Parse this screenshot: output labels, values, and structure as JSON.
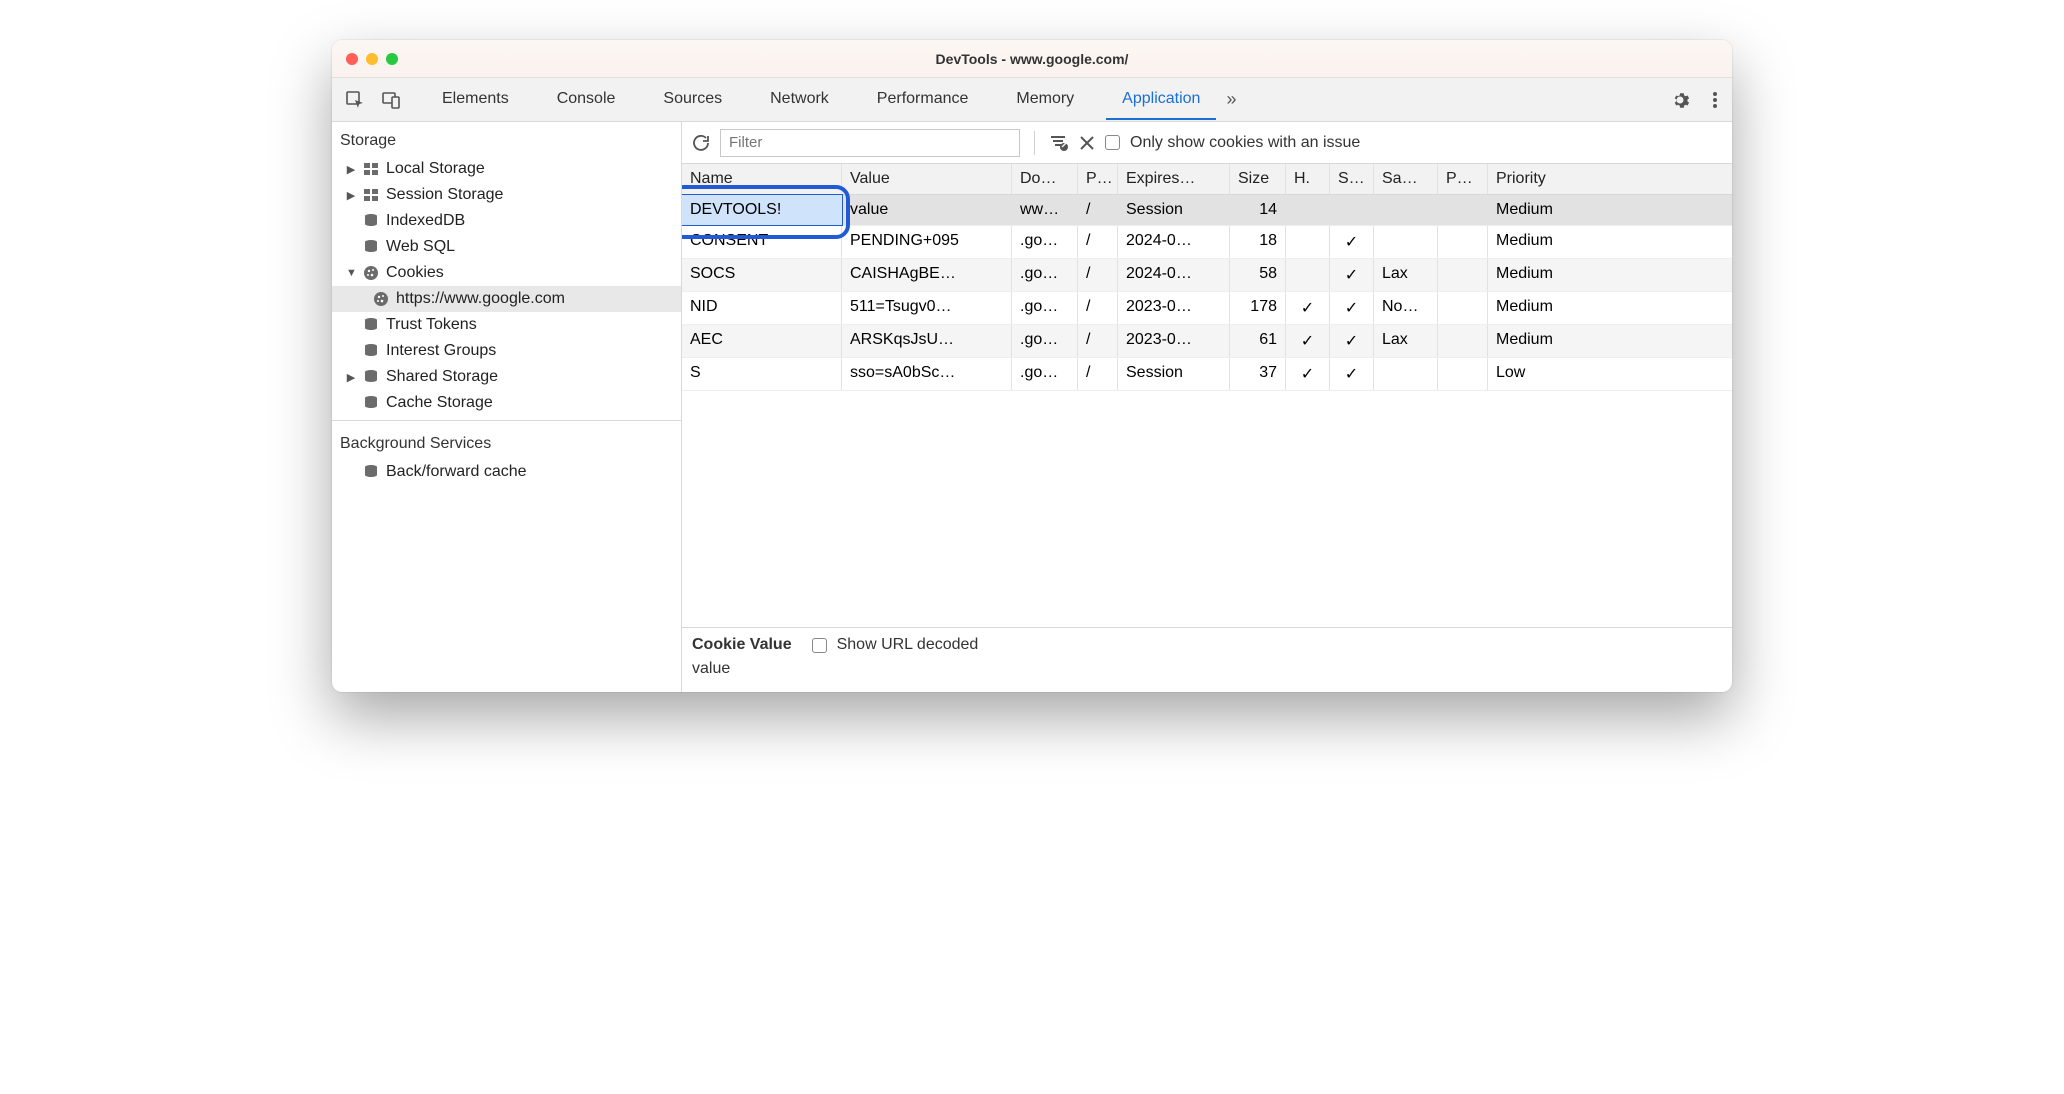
{
  "window": {
    "title": "DevTools - www.google.com/"
  },
  "tabs": {
    "items": [
      "Elements",
      "Console",
      "Sources",
      "Network",
      "Performance",
      "Memory",
      "Application"
    ],
    "active_index": 6,
    "overflow_glyph": "»"
  },
  "sidebar": {
    "sections": {
      "storage": {
        "label": "Storage",
        "items": [
          {
            "label": "Local Storage",
            "icon": "grid",
            "expandable": true,
            "expanded": false
          },
          {
            "label": "Session Storage",
            "icon": "grid",
            "expandable": true,
            "expanded": false
          },
          {
            "label": "IndexedDB",
            "icon": "db",
            "expandable": false
          },
          {
            "label": "Web SQL",
            "icon": "db",
            "expandable": false
          },
          {
            "label": "Cookies",
            "icon": "cookie",
            "expandable": true,
            "expanded": true,
            "children": [
              {
                "label": "https://www.google.com",
                "icon": "cookie",
                "selected": true
              }
            ]
          },
          {
            "label": "Trust Tokens",
            "icon": "db",
            "expandable": false
          },
          {
            "label": "Interest Groups",
            "icon": "db",
            "expandable": false
          },
          {
            "label": "Shared Storage",
            "icon": "db",
            "expandable": true,
            "expanded": false
          },
          {
            "label": "Cache Storage",
            "icon": "db",
            "expandable": false
          }
        ]
      },
      "background": {
        "label": "Background Services",
        "items": [
          {
            "label": "Back/forward cache",
            "icon": "db",
            "expandable": false
          }
        ]
      }
    }
  },
  "toolbar": {
    "filter_placeholder": "Filter",
    "show_issue_label": "Only show cookies with an issue"
  },
  "table": {
    "columns": [
      "Name",
      "Value",
      "Do…",
      "P…",
      "Expires…",
      "Size",
      "H.",
      "S…",
      "Sa…",
      "P…",
      "Priority"
    ],
    "rows": [
      {
        "name": "DEVTOOLS!",
        "value": "value",
        "domain": "ww…",
        "path": "/",
        "expires": "Session",
        "size": "14",
        "http": "",
        "secure": "",
        "samesite": "",
        "partition": "",
        "priority": "Medium",
        "editing": true,
        "selected": true
      },
      {
        "name": "CONSENT",
        "value": "PENDING+095",
        "domain": ".go…",
        "path": "/",
        "expires": "2024-0…",
        "size": "18",
        "http": "",
        "secure": "✓",
        "samesite": "",
        "partition": "",
        "priority": "Medium"
      },
      {
        "name": "SOCS",
        "value": "CAISHAgBE…",
        "domain": ".go…",
        "path": "/",
        "expires": "2024-0…",
        "size": "58",
        "http": "",
        "secure": "✓",
        "samesite": "Lax",
        "partition": "",
        "priority": "Medium"
      },
      {
        "name": "NID",
        "value": "511=Tsugv0…",
        "domain": ".go…",
        "path": "/",
        "expires": "2023-0…",
        "size": "178",
        "http": "✓",
        "secure": "✓",
        "samesite": "No…",
        "partition": "",
        "priority": "Medium"
      },
      {
        "name": "AEC",
        "value": "ARSKqsJsU…",
        "domain": ".go…",
        "path": "/",
        "expires": "2023-0…",
        "size": "61",
        "http": "✓",
        "secure": "✓",
        "samesite": "Lax",
        "partition": "",
        "priority": "Medium"
      },
      {
        "name": "S",
        "value": "sso=sA0bSc…",
        "domain": ".go…",
        "path": "/",
        "expires": "Session",
        "size": "37",
        "http": "✓",
        "secure": "✓",
        "samesite": "",
        "partition": "",
        "priority": "Low"
      }
    ]
  },
  "detail": {
    "header_label": "Cookie Value",
    "show_decoded_label": "Show URL decoded",
    "value": "value"
  }
}
